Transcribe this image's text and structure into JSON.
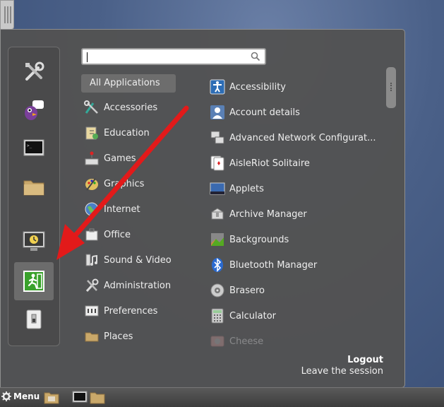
{
  "search": {
    "value": "",
    "placeholder": ""
  },
  "categories": {
    "selected": "All Applications",
    "items": [
      "Accessories",
      "Education",
      "Games",
      "Graphics",
      "Internet",
      "Office",
      "Sound & Video",
      "Administration",
      "Preferences",
      "Places"
    ]
  },
  "apps": {
    "items": [
      "Accessibility",
      "Account details",
      "Advanced Network Configurat...",
      "AisleRiot Solitaire",
      "Applets",
      "Archive Manager",
      "Backgrounds",
      "Bluetooth Manager",
      "Brasero",
      "Calculator",
      "Cheese"
    ]
  },
  "description": {
    "title": "Logout",
    "subtitle": "Leave the session"
  },
  "taskbar": {
    "menu_label": "Menu"
  },
  "favorites": [
    "settings-icon",
    "pidgin-icon",
    "terminal-icon",
    "folder-icon",
    "screensaver-icon",
    "logout-icon",
    "shutdown-icon"
  ],
  "colors": {
    "arrow": "#e21a1a",
    "menu_bg": "#525252",
    "logout_green": "#3aa12c"
  }
}
